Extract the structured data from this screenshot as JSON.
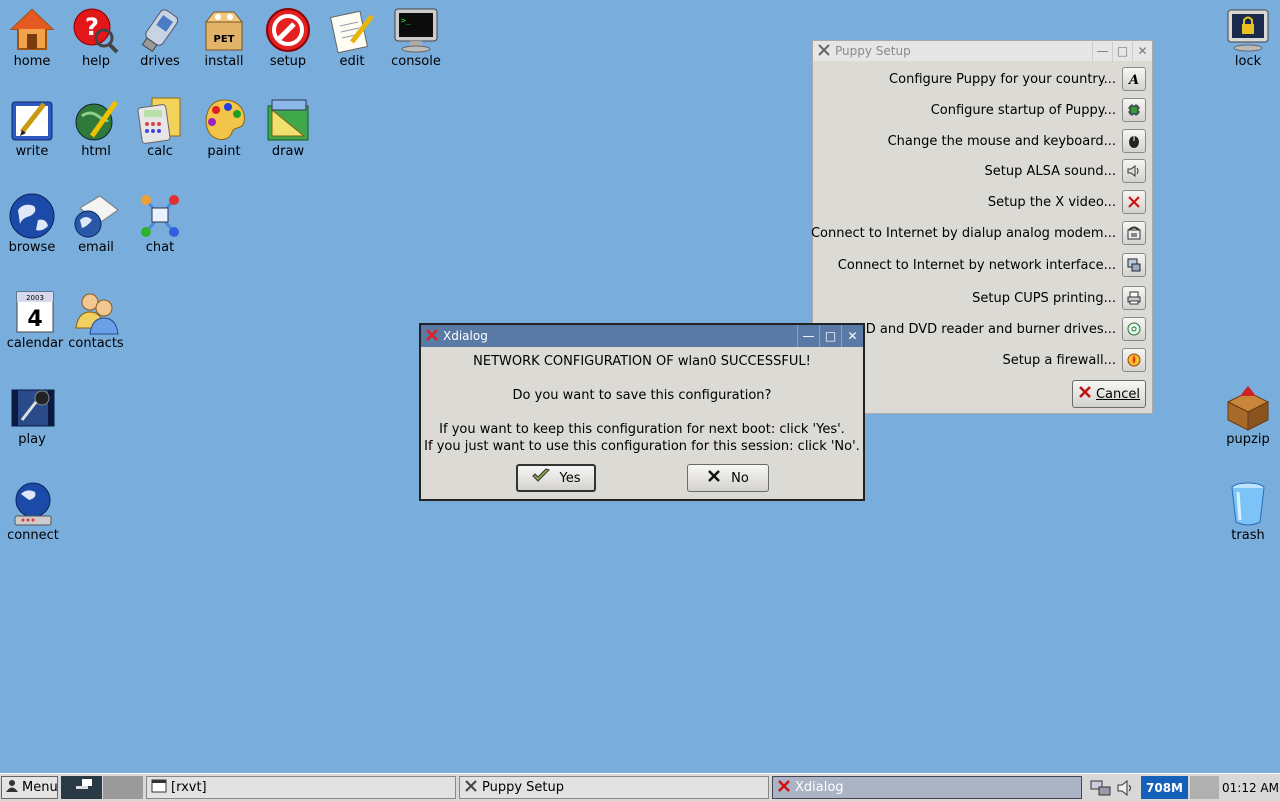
{
  "desktop": {
    "icons_left": [
      {
        "id": "home",
        "label": "home"
      },
      {
        "id": "help",
        "label": "help"
      },
      {
        "id": "drives",
        "label": "drives"
      },
      {
        "id": "install",
        "label": "install"
      },
      {
        "id": "setup",
        "label": "setup"
      },
      {
        "id": "edit",
        "label": "edit"
      },
      {
        "id": "console",
        "label": "console"
      },
      {
        "id": "write",
        "label": "write"
      },
      {
        "id": "html",
        "label": "html"
      },
      {
        "id": "calc",
        "label": "calc"
      },
      {
        "id": "paint",
        "label": "paint"
      },
      {
        "id": "draw",
        "label": "draw"
      },
      {
        "id": "browse",
        "label": "browse"
      },
      {
        "id": "email",
        "label": "email"
      },
      {
        "id": "chat",
        "label": "chat"
      },
      {
        "id": "calendar",
        "label": "calendar"
      },
      {
        "id": "contacts",
        "label": "contacts"
      },
      {
        "id": "play",
        "label": "play"
      },
      {
        "id": "connect",
        "label": "connect"
      }
    ],
    "icons_right": [
      {
        "id": "lock",
        "label": "lock"
      },
      {
        "id": "pupzip",
        "label": "pupzip"
      },
      {
        "id": "trash",
        "label": "trash"
      }
    ],
    "pet_label": "PET",
    "calendar_year": "2003",
    "calendar_day": "4"
  },
  "puppy_setup": {
    "title": "Puppy Setup",
    "items": [
      {
        "label": "Configure Puppy for your country...",
        "icon": "letter-a-icon"
      },
      {
        "label": "Configure startup of Puppy...",
        "icon": "chip-icon"
      },
      {
        "label": "Change the mouse and keyboard...",
        "icon": "mouse-icon"
      },
      {
        "label": "Setup ALSA sound...",
        "icon": "speaker-icon"
      },
      {
        "label": "Setup the X video...",
        "icon": "x-video-icon"
      },
      {
        "label": "Connect to Internet by dialup analog modem...",
        "icon": "phone-icon"
      },
      {
        "label": "Connect to Internet by network interface...",
        "icon": "network-icon"
      },
      {
        "label": "Setup CUPS printing...",
        "icon": "printer-icon"
      },
      {
        "label": "CD and DVD reader and burner drives...",
        "icon": "cd-icon"
      },
      {
        "label": "Setup a firewall...",
        "icon": "firewall-icon"
      }
    ],
    "cancel_label": "Cancel"
  },
  "xdialog": {
    "title": "Xdialog",
    "line1": "NETWORK CONFIGURATION OF wlan0 SUCCESSFUL!",
    "line2": "Do you want to save this configuration?",
    "line3": "If you want to keep this configuration for next boot: click 'Yes'.",
    "line4": "If you just want to use this configuration for this session: click 'No'.",
    "yes_label": "Yes",
    "no_label": "No"
  },
  "taskbar": {
    "menu_label": "Menu",
    "tasks": [
      {
        "label": "[rxvt]"
      },
      {
        "label": "Puppy Setup"
      },
      {
        "label": "Xdialog"
      }
    ],
    "memory": "708M",
    "clock": "01:12 AM"
  },
  "colors": {
    "desktop": "#79addc",
    "active_title": "#5a7aa6",
    "memory_bg": "#1560b8"
  }
}
